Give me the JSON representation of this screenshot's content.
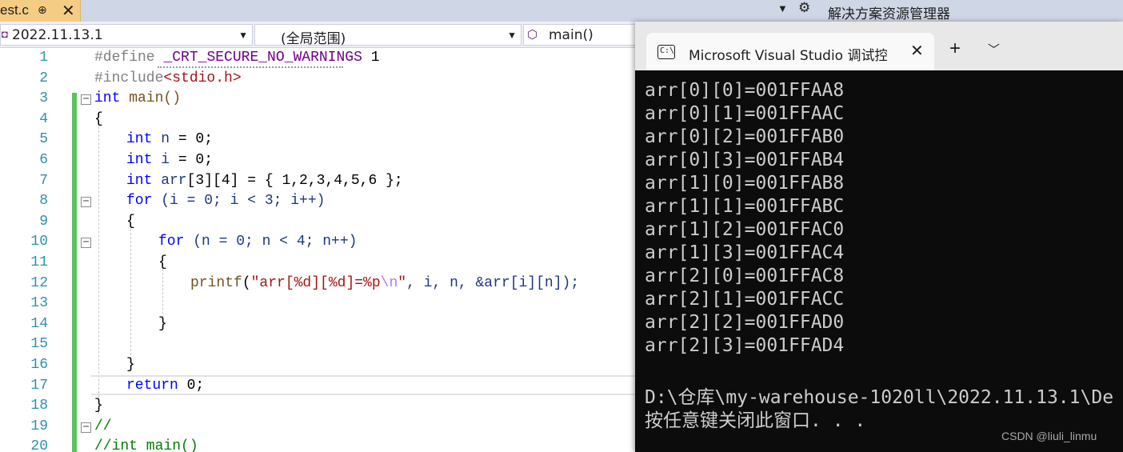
{
  "tabs": {
    "file_tab": {
      "label": "est.c",
      "pin": "⊕",
      "close": "✕"
    },
    "solution_explorer_title": "解决方案资源管理器"
  },
  "navbar": {
    "project": "2022.11.13.1",
    "scope": "(全局范围)",
    "function": "main()"
  },
  "editor": {
    "line_numbers": [
      "1",
      "2",
      "3",
      "4",
      "5",
      "6",
      "7",
      "8",
      "9",
      "10",
      "11",
      "12",
      "13",
      "14",
      "15",
      "16",
      "17",
      "18",
      "19",
      "20"
    ],
    "code": {
      "l1_pp": "#define",
      "l1_mac": "_CRT_SECURE_NO_WARNINGS",
      "l1_val": " 1",
      "l2_pp": "#include",
      "l2_hdr": "<stdio.h>",
      "l3_kw": "int",
      "l3_rest": " main()",
      "l4": "{",
      "l5_kw": "int",
      "l5_var": " n",
      "l5_rest": " = 0;",
      "l6_kw": "int",
      "l6_var": " i",
      "l6_rest": " = 0;",
      "l7_kw": "int",
      "l7_var": " arr",
      "l7_rest": "[3][4] = { 1,2,3,4,5,6 };",
      "l8_kw": "for",
      "l8_rest": " (i = 0; i < 3; i++)",
      "l9": "{",
      "l10_kw": "for",
      "l10_rest": " (n = 0; n < 4; n++)",
      "l11": "{",
      "l12_fn": "printf",
      "l12_open": "(",
      "l12_str": "\"arr[%d][%d]=%p",
      "l12_esc": "\\n",
      "l12_strend": "\"",
      "l12_rest": ", i, n, &arr[i][n]);",
      "l14": "}",
      "l16": "}",
      "l17_kw": "return",
      "l17_rest": " 0;",
      "l18": "}",
      "l19": "//",
      "l20": "//int main()"
    }
  },
  "console": {
    "title": "Microsoft Visual Studio 调试控制台",
    "tab_icon": "C:\\",
    "close": "✕",
    "new_tab": "+",
    "dropdown": "⌄",
    "output": [
      "arr[0][0]=001FFAA8",
      "arr[0][1]=001FFAAC",
      "arr[0][2]=001FFAB0",
      "arr[0][3]=001FFAB4",
      "arr[1][0]=001FFAB8",
      "arr[1][1]=001FFABC",
      "arr[1][2]=001FFAC0",
      "arr[1][3]=001FFAC4",
      "arr[2][0]=001FFAC8",
      "arr[2][1]=001FFACC",
      "arr[2][2]=001FFAD0",
      "arr[2][3]=001FFAD4",
      "",
      "D:\\仓库\\my-warehouse-1020ll\\2022.11.13.1\\De",
      "按任意键关闭此窗口. . ."
    ],
    "watermark": "CSDN @liuli_linmu"
  }
}
